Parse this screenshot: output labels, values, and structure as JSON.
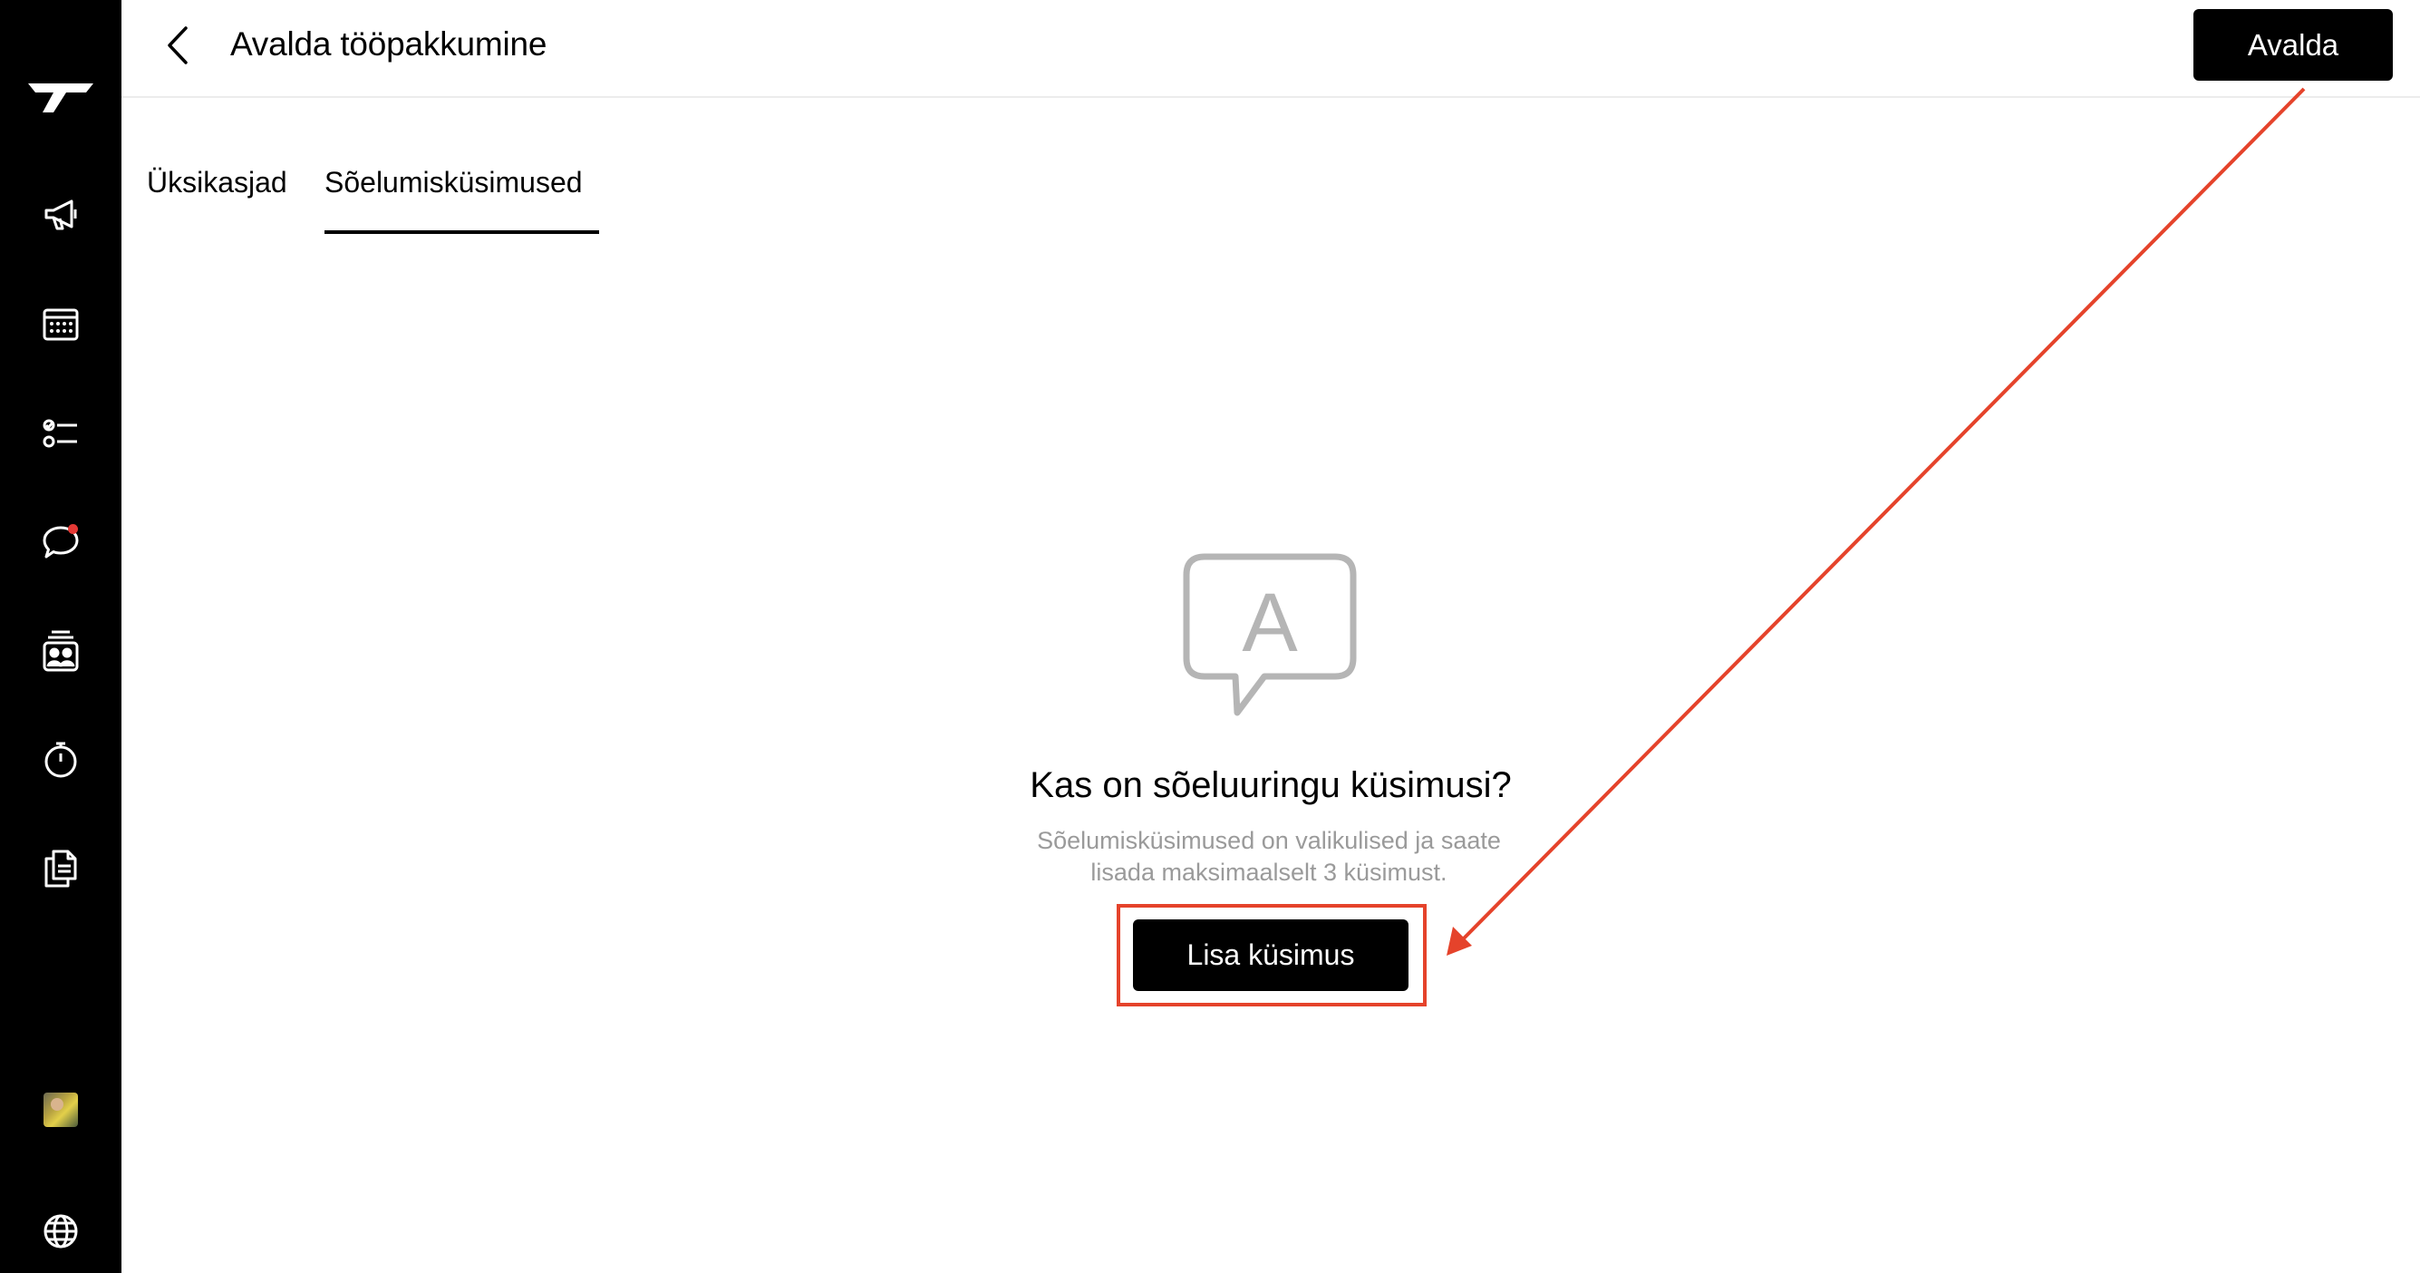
{
  "header": {
    "title": "Avalda tööpakkumine",
    "publish_label": "Avalda"
  },
  "tabs": [
    {
      "label": "Üksikasjad",
      "active": false
    },
    {
      "label": "Sõelumisküsimused",
      "active": true
    }
  ],
  "sidebar": {
    "items": [
      {
        "icon": "logo-icon"
      },
      {
        "icon": "megaphone-icon"
      },
      {
        "icon": "calendar-icon"
      },
      {
        "icon": "checklist-icon"
      },
      {
        "icon": "chat-icon",
        "notification": true
      },
      {
        "icon": "candidates-icon"
      },
      {
        "icon": "stopwatch-icon"
      },
      {
        "icon": "documents-icon"
      },
      {
        "icon": "avatar"
      },
      {
        "icon": "globe-icon"
      }
    ]
  },
  "empty_state": {
    "icon": "question-bubble-icon",
    "icon_letter": "A",
    "title": "Kas on sõeluuringu küsimusi?",
    "description": "Sõelumisküsimused on valikulised ja saate lisada maksimaalselt 3 küsimust.",
    "button_label": "Lisa küsimus"
  },
  "colors": {
    "sidebar_bg": "#000000",
    "primary_button": "#000000",
    "annotation": "#e5432b",
    "notification": "#e53935"
  }
}
